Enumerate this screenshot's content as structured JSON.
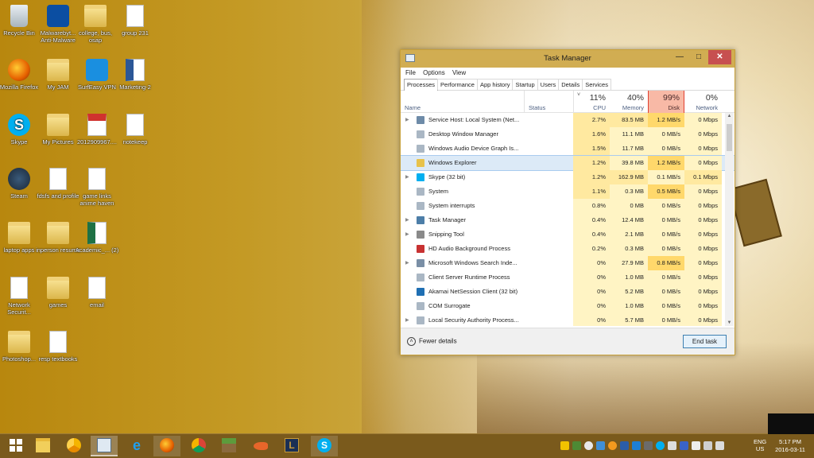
{
  "desktop": {
    "icons": [
      {
        "label": "Recycle Bin",
        "icon": "recycle-bin-icon"
      },
      {
        "label": "Malwarebyt... Anti-Malware",
        "icon": "malwarebytes-icon"
      },
      {
        "label": "college, bus, osap",
        "icon": "folder-icon"
      },
      {
        "label": "group 231",
        "icon": "document-icon"
      },
      {
        "label": "Mozilla Firefox",
        "icon": "firefox-icon"
      },
      {
        "label": "My JAM",
        "icon": "folder-icon"
      },
      {
        "label": "SurfEasy VPN",
        "icon": "surfeasy-icon"
      },
      {
        "label": "Marketing-2",
        "icon": "word-icon"
      },
      {
        "label": "Skype",
        "icon": "skype-icon"
      },
      {
        "label": "My Pictures",
        "icon": "folder-icon"
      },
      {
        "label": "2012909967....",
        "icon": "pdf-icon"
      },
      {
        "label": "notekeep",
        "icon": "document-icon"
      },
      {
        "label": "Steam",
        "icon": "steam-icon"
      },
      {
        "label": "fdsfs and profile",
        "icon": "document-icon"
      },
      {
        "label": "game links anime haven",
        "icon": "document-icon"
      },
      {
        "label": "laptop apps",
        "icon": "folder-icon"
      },
      {
        "label": "inperson resume",
        "icon": "folder-icon"
      },
      {
        "label": "Academic_... (2)",
        "icon": "excel-icon"
      },
      {
        "label": "Network Securit...",
        "icon": "document-icon"
      },
      {
        "label": "games",
        "icon": "folder-icon"
      },
      {
        "label": "email",
        "icon": "document-icon"
      },
      {
        "label": "Photoshop...",
        "icon": "folder-icon"
      },
      {
        "label": "resp textbooks",
        "icon": "document-icon"
      }
    ]
  },
  "task_manager": {
    "title": "Task Manager",
    "menu": [
      "File",
      "Options",
      "View"
    ],
    "tabs": [
      "Processes",
      "Performance",
      "App history",
      "Startup",
      "Users",
      "Details",
      "Services"
    ],
    "active_tab": "Processes",
    "columns": {
      "name": "Name",
      "status": "Status",
      "cpu": {
        "pct": "11%",
        "label": "CPU"
      },
      "memory": {
        "pct": "40%",
        "label": "Memory"
      },
      "disk": {
        "pct": "99%",
        "label": "Disk"
      },
      "network": {
        "pct": "0%",
        "label": "Network"
      }
    },
    "processes": [
      {
        "name": "Service Host: Local System (Net...",
        "expandable": true,
        "cpu": "2.7%",
        "memory": "83.5 MB",
        "disk": "1.2 MB/s",
        "network": "0 Mbps",
        "icon": "gear-icon"
      },
      {
        "name": "Desktop Window Manager",
        "expandable": false,
        "cpu": "1.6%",
        "memory": "11.1 MB",
        "disk": "0 MB/s",
        "network": "0 Mbps",
        "icon": "window-icon"
      },
      {
        "name": "Windows Audio Device Graph Is...",
        "expandable": false,
        "cpu": "1.5%",
        "memory": "11.7 MB",
        "disk": "0 MB/s",
        "network": "0 Mbps",
        "icon": "window-icon"
      },
      {
        "name": "Windows Explorer",
        "expandable": false,
        "cpu": "1.2%",
        "memory": "39.8 MB",
        "disk": "1.2 MB/s",
        "network": "0 Mbps",
        "icon": "folder-icon",
        "selected": true
      },
      {
        "name": "Skype (32 bit)",
        "expandable": true,
        "cpu": "1.2%",
        "memory": "162.9 MB",
        "disk": "0.1 MB/s",
        "network": "0.1 Mbps",
        "icon": "skype-icon"
      },
      {
        "name": "System",
        "expandable": false,
        "cpu": "1.1%",
        "memory": "0.3 MB",
        "disk": "0.5 MB/s",
        "network": "0 Mbps",
        "icon": "window-icon"
      },
      {
        "name": "System interrupts",
        "expandable": false,
        "cpu": "0.8%",
        "memory": "0 MB",
        "disk": "0 MB/s",
        "network": "0 Mbps",
        "icon": "window-icon"
      },
      {
        "name": "Task Manager",
        "expandable": true,
        "cpu": "0.4%",
        "memory": "12.4 MB",
        "disk": "0 MB/s",
        "network": "0 Mbps",
        "icon": "task-manager-icon"
      },
      {
        "name": "Snipping Tool",
        "expandable": true,
        "cpu": "0.4%",
        "memory": "2.1 MB",
        "disk": "0 MB/s",
        "network": "0 Mbps",
        "icon": "scissors-icon"
      },
      {
        "name": "HD Audio Background Process",
        "expandable": false,
        "cpu": "0.2%",
        "memory": "0.3 MB",
        "disk": "0 MB/s",
        "network": "0 Mbps",
        "icon": "speaker-icon"
      },
      {
        "name": "Microsoft Windows Search Inde...",
        "expandable": true,
        "cpu": "0%",
        "memory": "27.9 MB",
        "disk": "0.8 MB/s",
        "network": "0 Mbps",
        "icon": "search-icon"
      },
      {
        "name": "Client Server Runtime Process",
        "expandable": false,
        "cpu": "0%",
        "memory": "1.0 MB",
        "disk": "0 MB/s",
        "network": "0 Mbps",
        "icon": "window-icon"
      },
      {
        "name": "Akamai NetSession Client (32 bit)",
        "expandable": false,
        "cpu": "0%",
        "memory": "5.2 MB",
        "disk": "0 MB/s",
        "network": "0 Mbps",
        "icon": "akamai-icon"
      },
      {
        "name": "COM Surrogate",
        "expandable": false,
        "cpu": "0%",
        "memory": "1.0 MB",
        "disk": "0 MB/s",
        "network": "0 Mbps",
        "icon": "window-icon"
      },
      {
        "name": "Local Security Authority Process...",
        "expandable": true,
        "cpu": "0%",
        "memory": "5.7 MB",
        "disk": "0 MB/s",
        "network": "0 Mbps",
        "icon": "window-icon"
      }
    ],
    "footer": {
      "fewer_details": "Fewer details",
      "end_task": "End task"
    }
  },
  "taskbar": {
    "items": [
      "windows-start-icon",
      "file-explorer-icon",
      "chrome-canary-icon",
      "task-manager-icon",
      "internet-explorer-icon",
      "firefox-icon",
      "chrome-icon",
      "minecraft-icon",
      "fish-icon",
      "league-icon",
      "skype-icon"
    ],
    "active_item": "task-manager-icon",
    "language": {
      "line1": "ENG",
      "line2": "US"
    },
    "clock": {
      "time": "5:17 PM",
      "date": "2016-03-11"
    }
  },
  "colors": {
    "titlebar": "#d1ad52",
    "disk_highlight": "#f8b9a6",
    "close_button": "#c75050",
    "taskbar": "#7a5a1c"
  }
}
